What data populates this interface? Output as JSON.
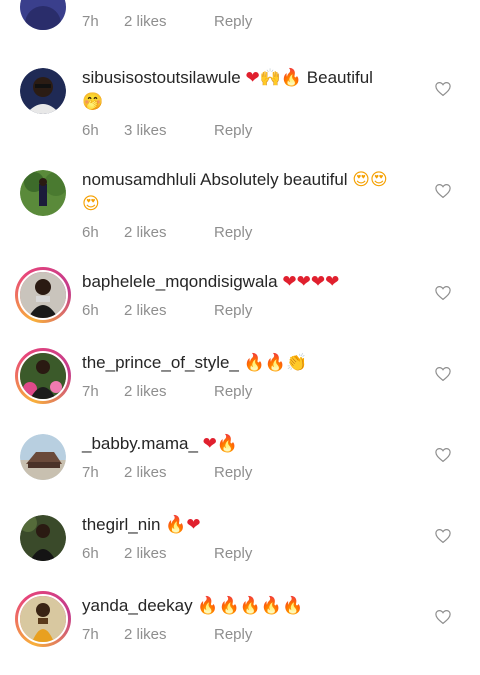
{
  "partial_comment": {
    "time": "7h",
    "likes": "2 likes",
    "reply": "Reply"
  },
  "comments": [
    {
      "user": "sibusisostoutsilawule",
      "text_after": " Beautiful",
      "time": "6h",
      "likes": "3 likes",
      "reply": "Reply",
      "avatar_ring": false
    },
    {
      "user": "nomusamdhluli",
      "text_after": " Absolutely beautiful ",
      "time": "6h",
      "likes": "2 likes",
      "reply": "Reply",
      "avatar_ring": false
    },
    {
      "user": "baphelele_mqondisigwala",
      "text_after": "",
      "time": "6h",
      "likes": "2 likes",
      "reply": "Reply",
      "avatar_ring": true
    },
    {
      "user": "the_prince_of_style_",
      "text_after": "",
      "time": "7h",
      "likes": "2 likes",
      "reply": "Reply",
      "avatar_ring": true
    },
    {
      "user": "_babby.mama_",
      "text_after": "",
      "time": "7h",
      "likes": "2 likes",
      "reply": "Reply",
      "avatar_ring": false
    },
    {
      "user": "thegirl_nin",
      "text_after": "",
      "time": "6h",
      "likes": "2 likes",
      "reply": "Reply",
      "avatar_ring": false
    },
    {
      "user": "yanda_deekay",
      "text_after": "",
      "time": "7h",
      "likes": "2 likes",
      "reply": "Reply",
      "avatar_ring": true
    }
  ],
  "icons": {
    "like": "heart-outline-icon"
  },
  "colors": {
    "text": "#262626",
    "meta": "#8e8e8e",
    "heart": "#e0202e",
    "fire": "#f26a10"
  }
}
